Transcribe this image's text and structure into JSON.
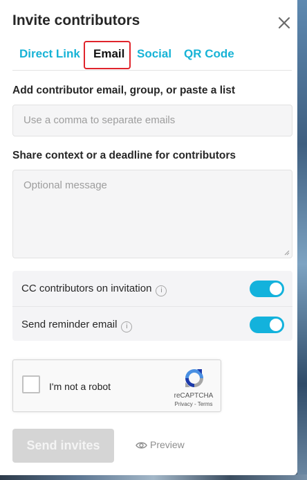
{
  "dialog": {
    "title": "Invite contributors"
  },
  "tabs": [
    {
      "label": "Direct Link",
      "active": false
    },
    {
      "label": "Email",
      "active": true
    },
    {
      "label": "Social",
      "active": false
    },
    {
      "label": "QR Code",
      "active": false
    }
  ],
  "email_field": {
    "label": "Add contributor email, group, or paste a list",
    "placeholder": "Use a comma to separate emails",
    "value": ""
  },
  "message_field": {
    "label": "Share context or a deadline for contributors",
    "placeholder": "Optional message",
    "value": ""
  },
  "options": [
    {
      "label": "CC contributors on invitation",
      "enabled": true,
      "info_icon": "info-icon"
    },
    {
      "label": "Send reminder email",
      "enabled": true,
      "info_icon": "info-icon"
    }
  ],
  "captcha": {
    "checkbox_label": "I'm not a robot",
    "brand": "reCAPTCHA",
    "links": "Privacy - Terms",
    "checked": false
  },
  "actions": {
    "send_label": "Send invites",
    "preview_label": "Preview",
    "preview_icon": "eye-icon"
  },
  "colors": {
    "accent": "#13b2dc",
    "tab_highlight": "#e0242b",
    "disabled_button": "#d5d5d5"
  }
}
